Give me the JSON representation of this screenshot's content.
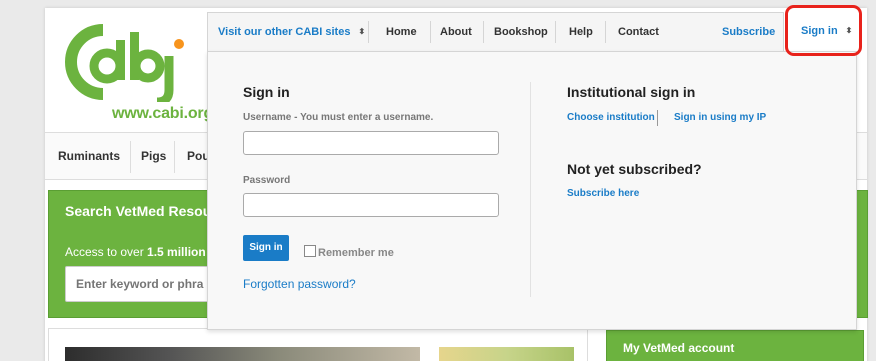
{
  "logo": {
    "url_text": "www.cabi.org",
    "brand_color": "#6cb33f",
    "accent_color": "#f7941d"
  },
  "category_nav": {
    "items": [
      "Ruminants",
      "Pigs",
      "Pou"
    ]
  },
  "search_panel": {
    "title": "Search VetMed Resou",
    "access_prefix": "Access to over ",
    "access_count": "1.5 million",
    "input_placeholder": "Enter keyword or phra"
  },
  "sidebar": {
    "my_account_label": "My VetMed account"
  },
  "top_nav": {
    "other_sites": "Visit our other CABI sites",
    "home": "Home",
    "about": "About",
    "bookshop": "Bookshop",
    "help": "Help",
    "contact": "Contact",
    "subscribe": "Subscribe",
    "sign_in": "Sign in",
    "caret_glyph": "⬍"
  },
  "signin_form": {
    "title": "Sign in",
    "username_label": "Username  - You must enter a username.",
    "username_value": "",
    "password_label": "Password",
    "password_value": "",
    "submit_label": "Sign in",
    "remember_label": "Remember me",
    "forgot_link": "Forgotten password?"
  },
  "institutional": {
    "title": "Institutional sign in",
    "choose_institution": "Choose institution",
    "sign_in_ip": "Sign in using my IP"
  },
  "subscription": {
    "title": "Not yet subscribed?",
    "subscribe_link": "Subscribe here"
  },
  "colors": {
    "link_blue": "#1a7cc7",
    "highlight_red": "#e8221b",
    "green": "#6cb33f"
  }
}
